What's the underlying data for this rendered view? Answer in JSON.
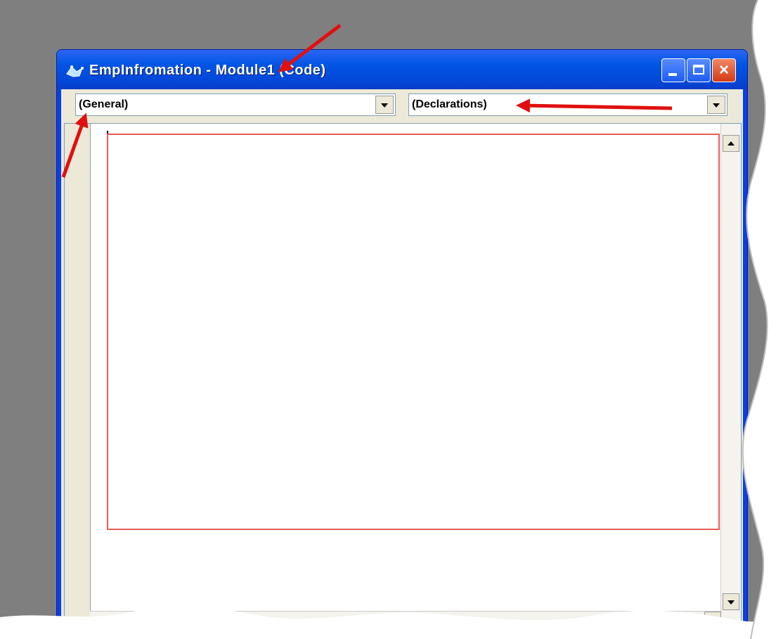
{
  "window": {
    "title": "EmpInfromation - Module1 (Code)",
    "controls": {
      "minimize": "minimize",
      "maximize": "maximize",
      "close": "×"
    }
  },
  "object_combo": {
    "selected": "(General)"
  },
  "procedure_combo": {
    "selected": "(Declarations)"
  },
  "colors": {
    "desktop": "#7f7f7f",
    "titlebar": "#0054e3",
    "client": "#ece9d8",
    "code_area_highlight": "#e85a5a",
    "annotation_arrow": "#e01010"
  },
  "icons": {
    "window_icon": "vb-module-icon",
    "combo_dropdown": "chevron-down-icon",
    "scroll_up": "arrow-up-icon",
    "scroll_down": "arrow-down-icon",
    "scroll_right": "arrow-right-icon"
  }
}
